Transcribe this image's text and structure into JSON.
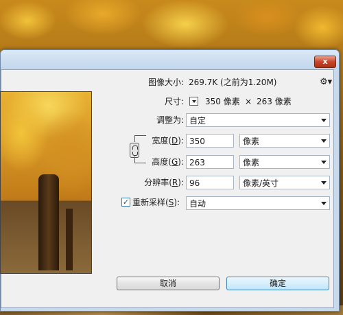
{
  "window": {
    "close_label": "x"
  },
  "image_size": {
    "label": "图像大小:",
    "value": "269.7K (之前为1.20M)"
  },
  "dimensions": {
    "label": "尺寸:",
    "width": "350 像素",
    "times": "×",
    "height": "263 像素"
  },
  "fit_to": {
    "label": "调整为:",
    "value": "自定"
  },
  "width": {
    "label": "宽度(",
    "key": "D",
    "label_end": "):",
    "value": "350",
    "unit": "像素"
  },
  "height": {
    "label": "高度(",
    "key": "G",
    "label_end": "):",
    "value": "263",
    "unit": "像素"
  },
  "resolution": {
    "label": "分辨率(",
    "key": "R",
    "label_end": "):",
    "value": "96",
    "unit": "像素/英寸"
  },
  "resample": {
    "checked": "✓",
    "label": "重新采样(",
    "key": "S",
    "label_end": "):",
    "value": "自动"
  },
  "buttons": {
    "cancel": "取消",
    "ok": "确定"
  },
  "icons": {
    "gear": "⚙▾",
    "link": "link-icon"
  }
}
